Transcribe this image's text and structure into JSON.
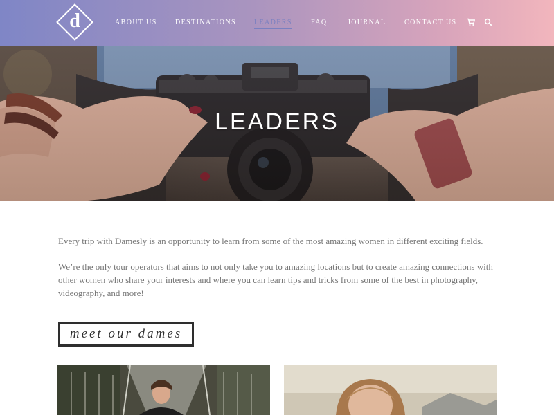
{
  "brand": {
    "logo_letter": "d"
  },
  "nav": {
    "items": [
      {
        "label": "ABOUT US"
      },
      {
        "label": "DESTINATIONS"
      },
      {
        "label": "LEADERS"
      },
      {
        "label": "FAQ"
      },
      {
        "label": "JOURNAL"
      },
      {
        "label": "CONTACT US"
      }
    ],
    "active_index": 2,
    "icons": [
      "cart-icon",
      "search-icon"
    ]
  },
  "hero": {
    "title": "LEADERS"
  },
  "intro": {
    "paragraphs": [
      "Every trip with Damesly is an opportunity to learn from some of the most amazing women in different exciting fields.",
      "We’re the only tour operators that aims to not only take you to amazing locations but to create amazing connections with other women who share your interests and where you can learn tips and tricks from some of the best in photography, videography, and more!"
    ]
  },
  "dames": {
    "label": "meet our dames"
  },
  "colors": {
    "header_gradient_start": "#7f86c6",
    "header_gradient_end": "#f2b6bd",
    "active_nav": "#7a80c0",
    "body_text": "#777777",
    "box_border": "#2e2e2e"
  }
}
